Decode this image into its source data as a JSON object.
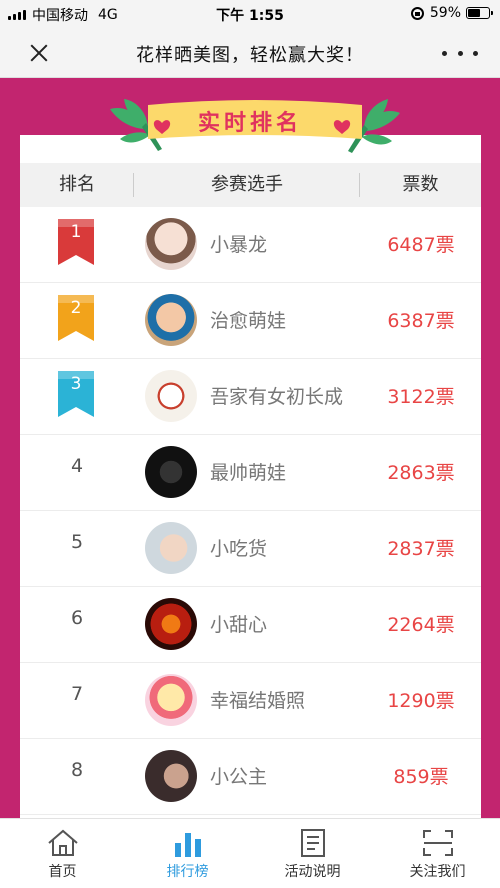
{
  "status_bar": {
    "carrier": "中国移动",
    "network": "4G",
    "time": "下午 1:55",
    "battery": "59%",
    "battery_level": 0.59
  },
  "nav": {
    "title": "花样晒美图，轻松赢大奖！",
    "close_icon": "close-icon",
    "more_icon": "more-icon"
  },
  "banner": {
    "title": "实时排名"
  },
  "table": {
    "headers": {
      "rank": "排名",
      "player": "参赛选手",
      "votes": "票数"
    },
    "rows": [
      {
        "rank": "1",
        "name": "小暴龙",
        "votes": "6487票",
        "ribbon_color": "#d93a3a"
      },
      {
        "rank": "2",
        "name": "治愈萌娃",
        "votes": "6387票",
        "ribbon_color": "#f2a31b"
      },
      {
        "rank": "3",
        "name": "吾家有女初长成",
        "votes": "3122票",
        "ribbon_color": "#2bb3d6"
      },
      {
        "rank": "4",
        "name": "最帅萌娃",
        "votes": "2863票"
      },
      {
        "rank": "5",
        "name": "小吃货",
        "votes": "2837票"
      },
      {
        "rank": "6",
        "name": "小甜心",
        "votes": "2264票"
      },
      {
        "rank": "7",
        "name": "幸福结婚照",
        "votes": "1290票"
      },
      {
        "rank": "8",
        "name": "小公主",
        "votes": "859票"
      }
    ]
  },
  "tabs": [
    {
      "label": "首页",
      "icon": "home-icon"
    },
    {
      "label": "排行榜",
      "icon": "bar-chart-icon",
      "active": true
    },
    {
      "label": "活动说明",
      "icon": "document-icon"
    },
    {
      "label": "关注我们",
      "icon": "qr-scan-icon"
    }
  ],
  "colors": {
    "page_background": "#c2256f",
    "accent_blue": "#2e9bde",
    "votes_red": "#e84545",
    "banner_red": "#e0325f"
  }
}
